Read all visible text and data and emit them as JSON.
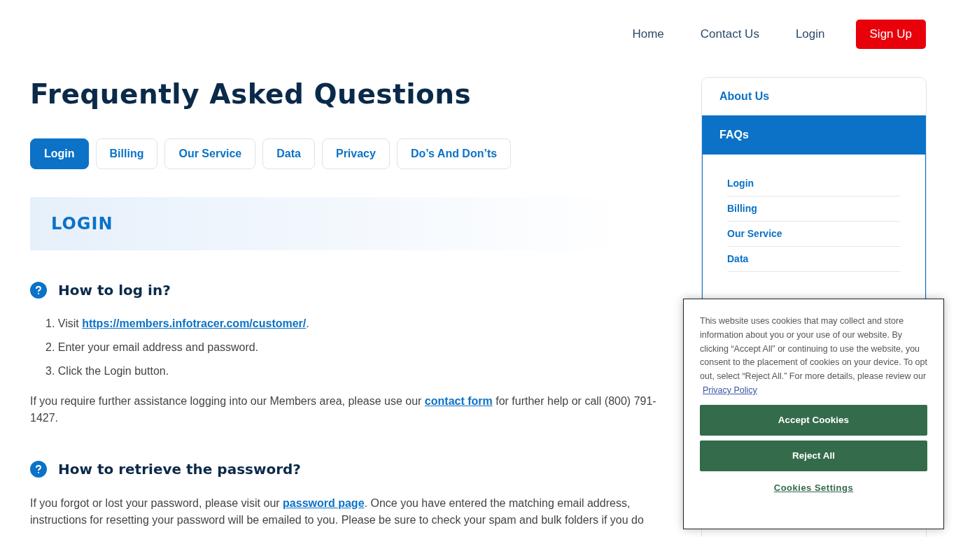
{
  "nav": [
    {
      "label": "Home",
      "kind": "link"
    },
    {
      "label": "Contact Us",
      "kind": "link"
    },
    {
      "label": "Login",
      "kind": "link"
    },
    {
      "label": "Sign Up",
      "kind": "button"
    }
  ],
  "page_title": "Frequently Asked Questions",
  "tabs": [
    {
      "label": "Login",
      "selected": true
    },
    {
      "label": "Billing",
      "selected": false
    },
    {
      "label": "Our Service",
      "selected": false
    },
    {
      "label": "Data",
      "selected": false
    },
    {
      "label": "Privacy",
      "selected": false
    },
    {
      "label": "Do’s And Don’ts",
      "selected": false
    }
  ],
  "section_heading": "LOGIN",
  "questions": [
    {
      "question": "How to log in?",
      "steps": [
        {
          "number": "1.",
          "parts": [
            {
              "text": "Visit "
            },
            {
              "link": "https://members.infotracer.com/customer/"
            },
            {
              "text": "."
            }
          ]
        },
        {
          "number": "2.",
          "parts": [
            {
              "text": "Enter your email address and password."
            }
          ]
        },
        {
          "number": "3.",
          "parts": [
            {
              "text": "Click the Login button."
            }
          ]
        }
      ],
      "paragraph": [
        {
          "text": "If you require further assistance logging into our Members area, please use our "
        },
        {
          "link": "contact form"
        },
        {
          "text": " for further help or call (800) 791-1427."
        }
      ]
    },
    {
      "question": "How to retrieve the password?",
      "paragraph": [
        {
          "text": "If you forgot or lost your password, please visit our "
        },
        {
          "link": "password page"
        },
        {
          "text": ". Once you have entered the matching email address, instructions for resetting your password will be emailed to you. Please be sure to check your spam and bulk folders if you do"
        }
      ]
    }
  ],
  "sidebar": {
    "items": [
      {
        "label": "About Us",
        "selected": false
      },
      {
        "label": "FAQs",
        "selected": true
      }
    ],
    "subitems": [
      "Login",
      "Billing",
      "Our Service",
      "Data"
    ]
  },
  "cookie_banner": {
    "text": "This website uses cookies that may collect and store information about you or your use of our website. By clicking “Accept All” or continuing to use the website, you consent to the placement of cookies on your device. To opt out, select “Reject All.” For more details, please review our ",
    "link": "Privacy Policy",
    "buttons": [
      "Accept Cookies",
      "Reject All"
    ],
    "settings_link": "Cookies Settings"
  }
}
